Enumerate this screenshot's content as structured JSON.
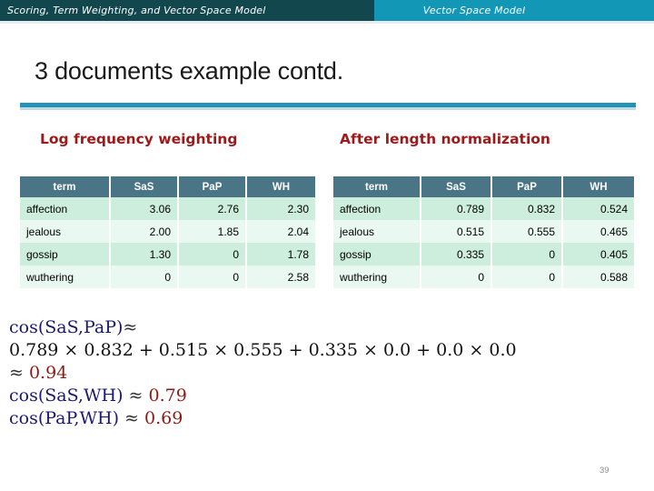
{
  "banner": {
    "left_title": "Scoring, Term Weighting, and Vector Space Model",
    "right_title": "Vector Space Model",
    "left_bg": "#13474e",
    "right_bg": "#1298b6"
  },
  "slide": {
    "title": "3 documents example contd.",
    "rule_color": "#2293b4",
    "page_number": "39"
  },
  "sections": {
    "left_caption": "Log frequency weighting",
    "right_caption": "After length normalization",
    "caption_color": "#9e1a1a"
  },
  "tables": {
    "header_bg": "#4a7586",
    "row_odd_bg": "#cdeedd",
    "row_even_bg": "#e9f8f0",
    "log_frequency": {
      "columns": [
        "term",
        "SaS",
        "PaP",
        "WH"
      ],
      "rows": [
        [
          "affection",
          "3.06",
          "2.76",
          "2.30"
        ],
        [
          "jealous",
          "2.00",
          "1.85",
          "2.04"
        ],
        [
          "gossip",
          "1.30",
          "0",
          "1.78"
        ],
        [
          "wuthering",
          "0",
          "0",
          "2.58"
        ]
      ]
    },
    "length_normalized": {
      "columns": [
        "term",
        "SaS",
        "PaP",
        "WH"
      ],
      "rows": [
        [
          "affection",
          "0.789",
          "0.832",
          "0.524"
        ],
        [
          "jealous",
          "0.515",
          "0.555",
          "0.465"
        ],
        [
          "gossip",
          "0.335",
          "0",
          "0.405"
        ],
        [
          "wuthering",
          "0",
          "0",
          "0.588"
        ]
      ]
    }
  },
  "formulas": {
    "line1_cos": "cos(SaS,PaP)",
    "line1_approx": "≈",
    "line2": "0.789 × 0.832 + 0.515 × 0.555 + 0.335 × 0.0 + 0.0 × 0.0",
    "line3_approx": "≈",
    "line3_value": "0.94",
    "line4_cos": "cos(SaS,WH)",
    "line4_approx": "≈",
    "line4_value": "0.79",
    "line5_cos": "cos(PaP,WH)",
    "line5_approx": "≈",
    "line5_value": "0.69",
    "cos_color": "#191970",
    "value_color": "#8b1a14"
  }
}
